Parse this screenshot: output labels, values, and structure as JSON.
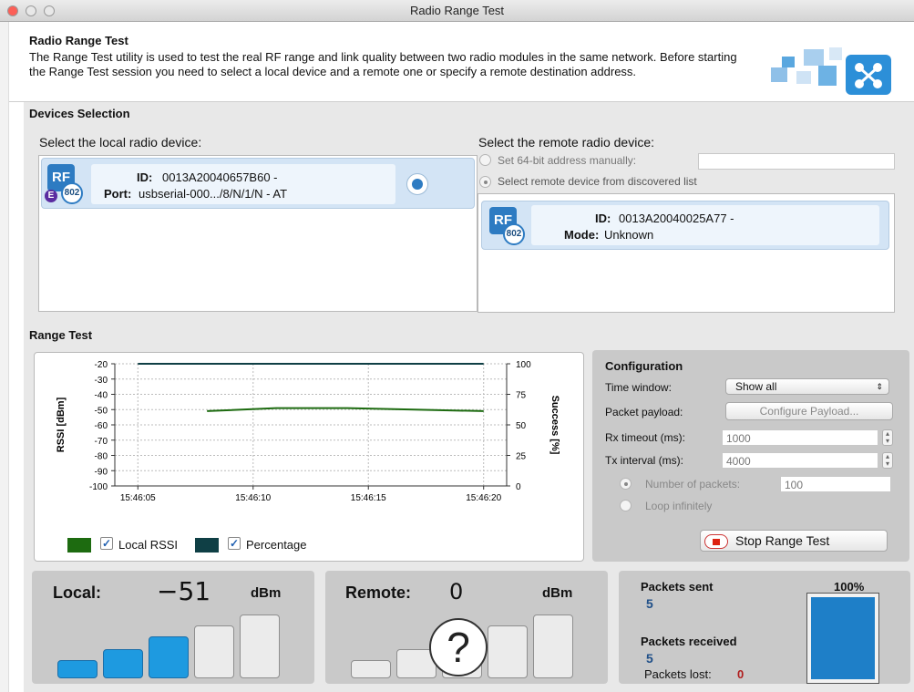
{
  "window": {
    "title": "Radio Range Test"
  },
  "header": {
    "title": "Radio Range Test",
    "description": "The Range Test utility is used to test the real RF range and link quality between two radio modules in the same network. Before starting the Range Test session you need to select a local device and a remote one or specify a remote destination address."
  },
  "devices": {
    "title": "Devices Selection",
    "local": {
      "label": "Select the local radio device:",
      "id_label": "ID:",
      "id_value": "0013A20040657B60 -",
      "port_label": "Port:",
      "port_value": "usbserial-000.../8/N/1/N - AT",
      "icon_text": "RF",
      "badge_text": "802",
      "e_text": "E"
    },
    "remote": {
      "label": "Select the remote radio device:",
      "manual_option": "Set 64-bit address manually:",
      "manual_value": "",
      "discovered_option": "Select remote device from discovered list",
      "id_label": "ID:",
      "id_value": "0013A20040025A77 -",
      "mode_label": "Mode:",
      "mode_value": "Unknown",
      "icon_text": "RF",
      "badge_text": "802"
    }
  },
  "range_test": {
    "title": "Range Test",
    "legend": {
      "local_rssi": "Local RSSI",
      "percentage": "Percentage",
      "local_color": "#1d6b10",
      "percentage_color": "#0f3f45"
    }
  },
  "chart_data": {
    "type": "line",
    "x": [
      "15:46:08",
      "15:46:11",
      "15:46:14",
      "15:46:17",
      "15:46:20"
    ],
    "xticks": [
      "15:46:05",
      "15:46:10",
      "15:46:15",
      "15:46:20"
    ],
    "ylabel": "RSSI [dBm]",
    "y2label": "Success [%]",
    "ylim": [
      -100,
      -20
    ],
    "yticks": [
      "-20",
      "-30",
      "-40",
      "-50",
      "-60",
      "-70",
      "-80",
      "-90",
      "-100"
    ],
    "y2lim": [
      0,
      100
    ],
    "y2ticks": [
      "100",
      "75",
      "50",
      "25",
      "0"
    ],
    "series": [
      {
        "name": "Local RSSI",
        "axis": "left",
        "x": [
          8,
          11,
          14,
          17,
          20
        ],
        "values": [
          -51,
          -49,
          -49,
          -50,
          -51
        ],
        "color": "#1d6b10"
      },
      {
        "name": "Percentage",
        "axis": "right",
        "x": [
          5,
          20
        ],
        "values": [
          100,
          100
        ],
        "color": "#0f3f45"
      }
    ],
    "xlim": [
      4,
      21
    ],
    "grid": true
  },
  "configuration": {
    "title": "Configuration",
    "time_window_label": "Time window:",
    "time_window_value": "Show all",
    "packet_payload_label": "Packet payload:",
    "configure_payload_button": "Configure Payload...",
    "rx_timeout_label": "Rx timeout (ms):",
    "rx_timeout_value": "1000",
    "tx_interval_label": "Tx interval (ms):",
    "tx_interval_value": "4000",
    "num_packets_label": "Number of packets:",
    "num_packets_value": "100",
    "loop_label": "Loop infinitely",
    "stop_button": "Stop Range Test"
  },
  "local_stats": {
    "label": "Local:",
    "value": "−51",
    "unit": "dBm",
    "signal_bars_on": 3,
    "signal_bars_total": 5
  },
  "remote_stats": {
    "label": "Remote:",
    "value": "0",
    "unit": "dBm",
    "unknown_symbol": "?",
    "signal_bars_on": 0,
    "signal_bars_total": 5
  },
  "packets": {
    "sent_label": "Packets sent",
    "sent_value": "5",
    "received_label": "Packets received",
    "received_value": "5",
    "lost_label": "Packets lost:",
    "lost_value": "0",
    "percent_label": "100%",
    "percent_fill": 1.0
  }
}
